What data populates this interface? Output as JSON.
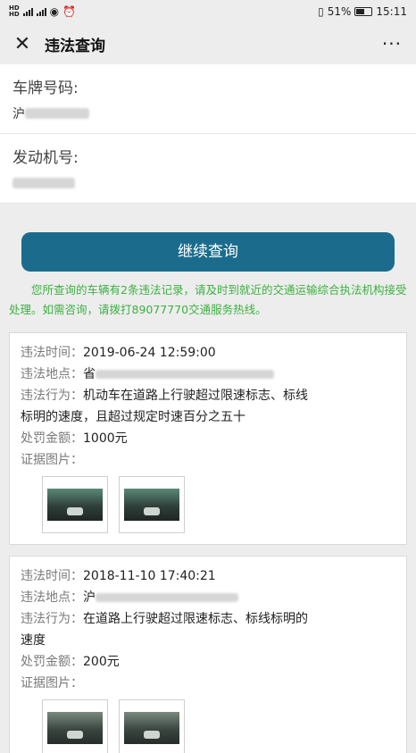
{
  "status": {
    "battery": "51%",
    "time": "15:11"
  },
  "nav": {
    "title": "违法查询",
    "more": "···"
  },
  "plate": {
    "label": "车牌号码:",
    "value_prefix": "沪"
  },
  "engine": {
    "label": "发动机号:"
  },
  "continue_button": "继续查询",
  "notice": "您所查询的车辆有2条违法记录，请及时到就近的交通运输综合执法机构接受处理。如需咨询，请拨打89077770交通服务热线。",
  "labels": {
    "time": "违法时间：",
    "place": "违法地点：",
    "behavior": "违法行为：",
    "fine": "处罚金额：",
    "evidence": "证据图片："
  },
  "records": [
    {
      "time": "2019-06-24 12:59:00",
      "place_prefix": "省",
      "behavior_line1": "机动车在道路上行驶超过限速标志、标线",
      "behavior_line2": "标明的速度，且超过规定时速百分之五十",
      "fine": "1000元"
    },
    {
      "time": "2018-11-10 17:40:21",
      "place_prefix": "沪",
      "behavior_line1": "在道路上行驶超过限速标志、标线标明的",
      "behavior_line2": "速度",
      "fine": "200元"
    }
  ]
}
